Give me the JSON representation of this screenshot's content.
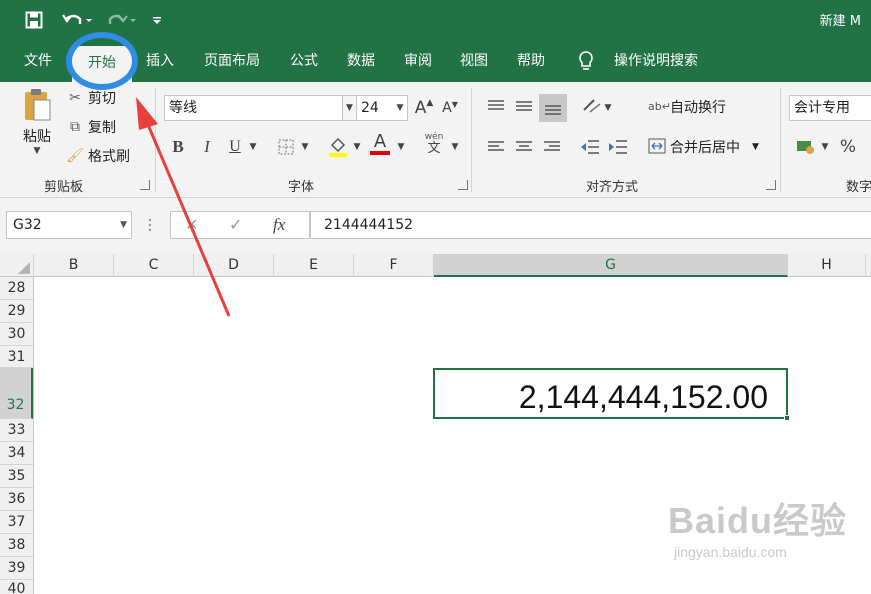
{
  "titlebar": {
    "document_title": "新建 M",
    "save_icon": "save-icon",
    "undo_icon": "undo-icon",
    "redo_icon": "redo-icon",
    "customize_icon": "customize-qat-icon"
  },
  "tabs": [
    {
      "label": "文件"
    },
    {
      "label": "开始"
    },
    {
      "label": "插入"
    },
    {
      "label": "页面布局"
    },
    {
      "label": "公式"
    },
    {
      "label": "数据"
    },
    {
      "label": "审阅"
    },
    {
      "label": "视图"
    },
    {
      "label": "帮助"
    },
    {
      "label": "操作说明搜索"
    }
  ],
  "ribbon": {
    "clipboard": {
      "paste": "粘贴",
      "cut": "剪切",
      "copy": "复制",
      "format_painter": "格式刷",
      "group_label": "剪贴板"
    },
    "font": {
      "font_name": "等线",
      "font_size": "24",
      "group_label": "字体",
      "bold": "B",
      "italic": "I",
      "underline": "U",
      "grow": "A",
      "shrink": "A",
      "phonetic_top": "wén",
      "phonetic_bottom": "文",
      "font_color": "A"
    },
    "alignment": {
      "wrap_text": "自动换行",
      "merge_center": "合并后居中",
      "group_label": "对齐方式"
    },
    "number": {
      "format": "会计专用",
      "group_label_partial": "数字",
      "percent": "%"
    }
  },
  "formula_bar": {
    "name_box": "G32",
    "fx": "fx",
    "formula": "2144444152"
  },
  "grid": {
    "columns": [
      "B",
      "C",
      "D",
      "E",
      "F",
      "G",
      "H"
    ],
    "rows": [
      "28",
      "29",
      "30",
      "31",
      "32",
      "33",
      "34",
      "35",
      "36",
      "37",
      "38",
      "39",
      "40"
    ],
    "active_cell_display": "2,144,444,152.00"
  },
  "watermark": {
    "brand": "Baidu经验",
    "url": "jingyan.baidu.com"
  },
  "colors": {
    "excel_green": "#217346",
    "annotation_circle": "#2f8de4",
    "annotation_arrow": "#e8403a"
  }
}
